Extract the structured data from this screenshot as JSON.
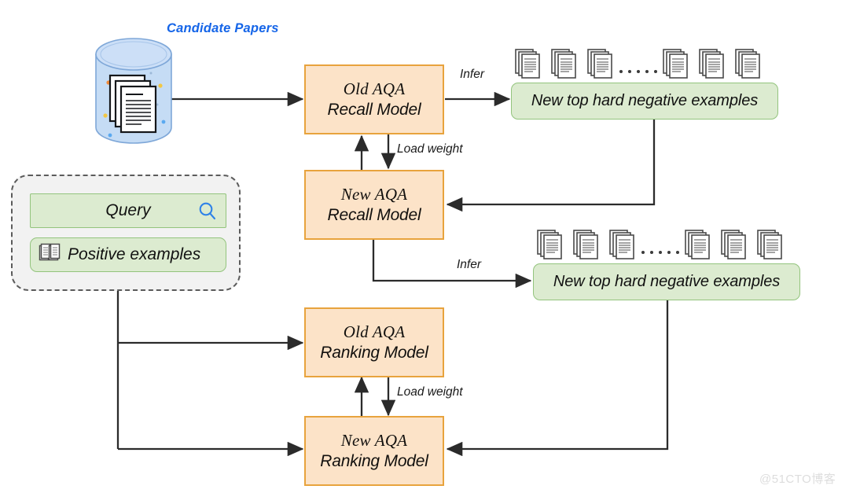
{
  "diagram": {
    "title_candidate_papers": "Candidate Papers",
    "watermark": "@51CTO博客",
    "colors": {
      "model_fill": "#fce3c8",
      "model_stroke": "#e8a33d",
      "example_fill": "#dcebd0",
      "example_stroke": "#93c47d",
      "group_fill": "#f2f2f2",
      "group_stroke": "#5b5b5b",
      "title_blue": "#1565e8",
      "cylinder_blue": "#c5dcf5",
      "arrow": "#2b2b2b"
    },
    "query_group": {
      "query_label": "Query",
      "query_icon": "search-icon",
      "positive_label": "Positive examples",
      "positive_icon": "open-book-icon"
    },
    "models": [
      {
        "id": "old-recall",
        "line1": "Old AQA",
        "line2": "Recall Model"
      },
      {
        "id": "new-recall",
        "line1": "New AQA",
        "line2": "Recall Model"
      },
      {
        "id": "old-ranking",
        "line1": "Old AQA",
        "line2": "Ranking Model"
      },
      {
        "id": "new-ranking",
        "line1": "New AQA",
        "line2": "Ranking Model"
      }
    ],
    "example_boxes": [
      {
        "id": "hard-neg-1",
        "label": "New top hard negative examples",
        "doc_count": 6,
        "ellipsis_dots": 5
      },
      {
        "id": "hard-neg-2",
        "label": "New top hard negative examples",
        "doc_count": 6,
        "ellipsis_dots": 5
      }
    ],
    "edge_labels": [
      {
        "id": "infer-1",
        "text": "Infer"
      },
      {
        "id": "load-weight-1",
        "text": "Load weight"
      },
      {
        "id": "infer-2",
        "text": "Infer"
      },
      {
        "id": "load-weight-2",
        "text": "Load weight"
      }
    ]
  }
}
